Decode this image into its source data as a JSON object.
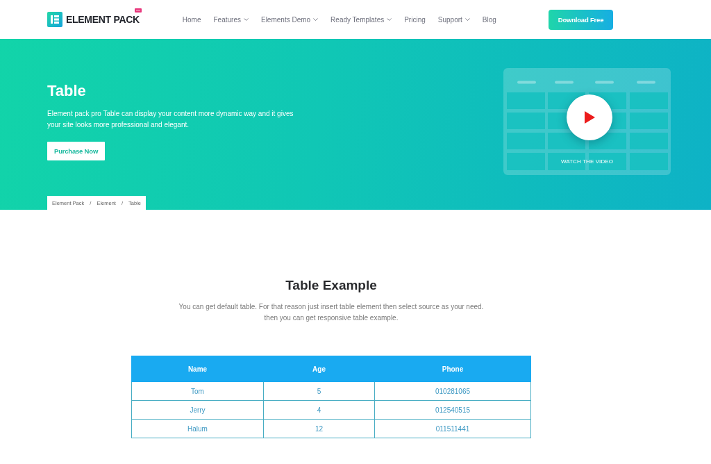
{
  "header": {
    "logo": {
      "text": "ELEMENT PACK"
    },
    "nav": [
      {
        "label": "Home",
        "dropdown": false
      },
      {
        "label": "Features",
        "dropdown": true
      },
      {
        "label": "Elements Demo",
        "dropdown": true
      },
      {
        "label": "Ready Templates",
        "dropdown": true
      },
      {
        "label": "Pricing",
        "dropdown": false
      },
      {
        "label": "Support",
        "dropdown": true
      },
      {
        "label": "Blog",
        "dropdown": false
      }
    ],
    "cta": "Download Free"
  },
  "hero": {
    "title": "Table",
    "description": "Element pack pro Table can display your content more dynamic way and it gives your site looks more professional and elegant.",
    "button": "Purchase Now",
    "breadcrumb": {
      "items": [
        "Element Pack",
        "Element",
        "Table"
      ],
      "separator": "/"
    },
    "video": {
      "caption": "WATCH THE VIDEO"
    }
  },
  "section": {
    "title": "Table Example",
    "description": "You can get default table. For that reason just insert table element then select source as your need. then you can get responsive table example."
  },
  "table": {
    "columns": [
      "Name",
      "Age",
      "Phone"
    ],
    "rows": [
      [
        "Tom",
        "5",
        "010281065"
      ],
      [
        "Jerry",
        "4",
        "012540515"
      ],
      [
        "Halum",
        "12",
        "011511441"
      ]
    ]
  }
}
